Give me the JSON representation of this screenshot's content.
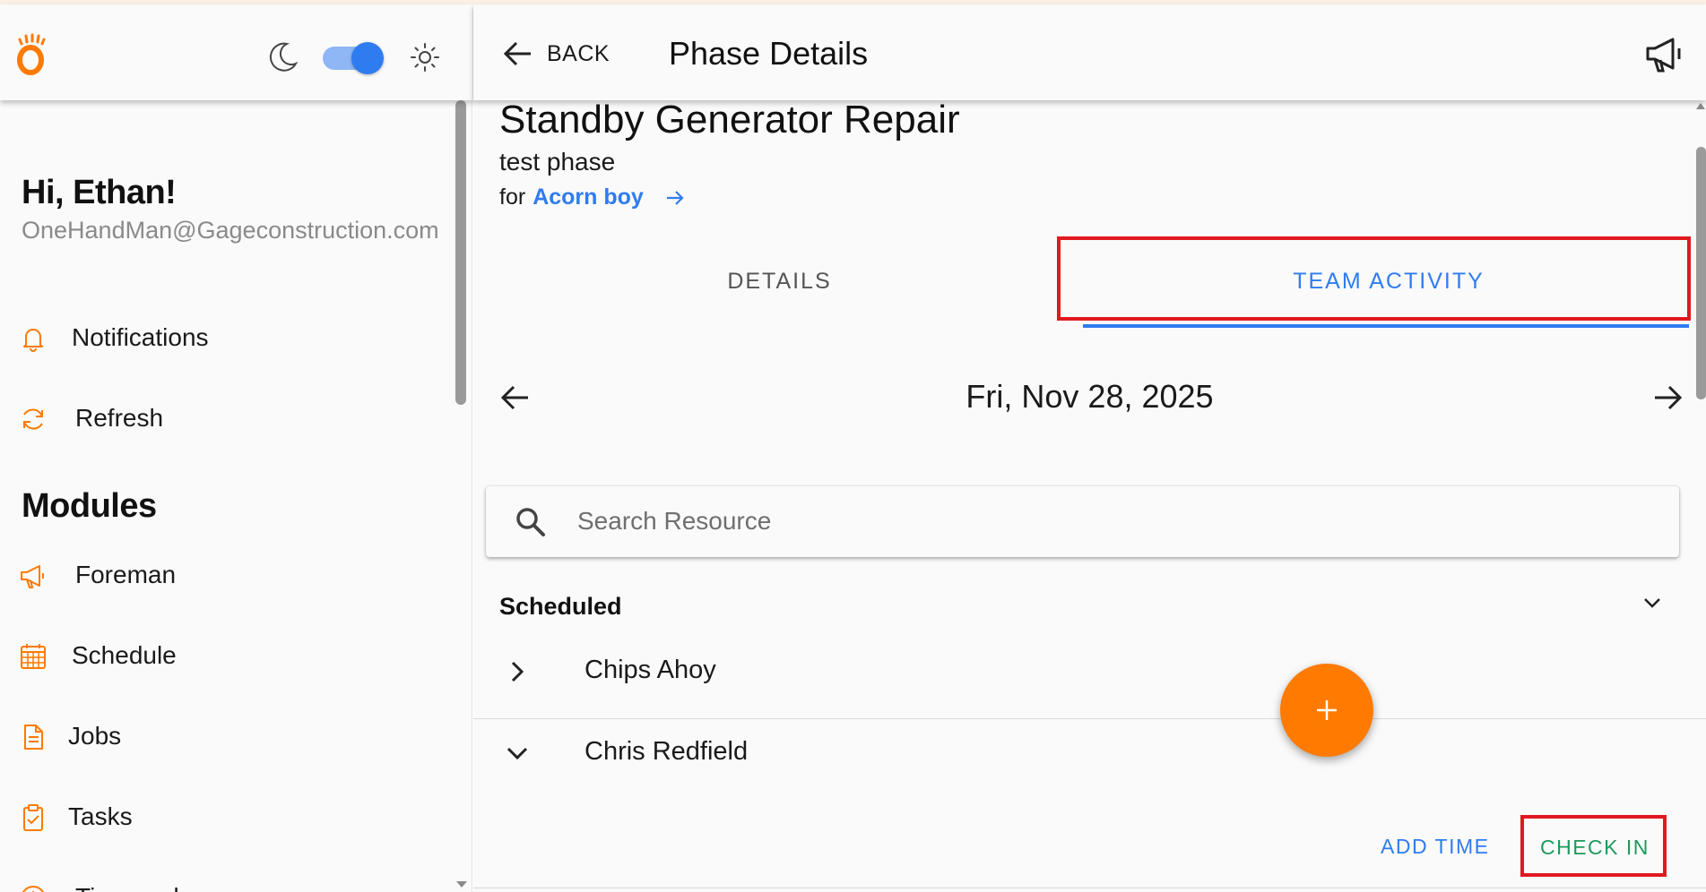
{
  "colors": {
    "accent_orange": "#ff7a00",
    "link_blue": "#2f7cf0",
    "check_in_green": "#1e9a5c",
    "highlight_red": "#e0191f"
  },
  "sidebar": {
    "theme_toggle": {
      "dark_icon": "moon-icon",
      "light_icon": "sun-icon",
      "state": "on"
    },
    "greeting": "Hi, Ethan!",
    "email": "OneHandMan@Gageconstruction.com",
    "top_items": [
      {
        "label": "Notifications",
        "icon": "bell-icon"
      },
      {
        "label": "Refresh",
        "icon": "refresh-icon"
      }
    ],
    "modules_title": "Modules",
    "modules": [
      {
        "label": "Foreman",
        "icon": "megaphone-icon"
      },
      {
        "label": "Schedule",
        "icon": "calendar-icon"
      },
      {
        "label": "Jobs",
        "icon": "document-icon"
      },
      {
        "label": "Tasks",
        "icon": "clipboard-check-icon"
      },
      {
        "label": "Timecard",
        "icon": "clock-icon"
      }
    ]
  },
  "header": {
    "back_label": "BACK",
    "title": "Phase Details"
  },
  "phase": {
    "job_title": "Standby Generator Repair",
    "phase_name": "test phase",
    "for_prefix": "for",
    "client": "Acorn boy"
  },
  "tabs": [
    {
      "label": "DETAILS",
      "active": false
    },
    {
      "label": "TEAM ACTIVITY",
      "active": true
    }
  ],
  "date_nav": {
    "date": "Fri, Nov 28, 2025"
  },
  "search": {
    "placeholder": "Search Resource",
    "value": ""
  },
  "scheduled": {
    "title": "Scheduled",
    "resources": [
      {
        "name": "Chips Ahoy",
        "expanded": false
      },
      {
        "name": "Chris Redfield",
        "expanded": true
      }
    ],
    "actions": {
      "add_time": "ADD TIME",
      "check_in": "CHECK IN"
    }
  }
}
